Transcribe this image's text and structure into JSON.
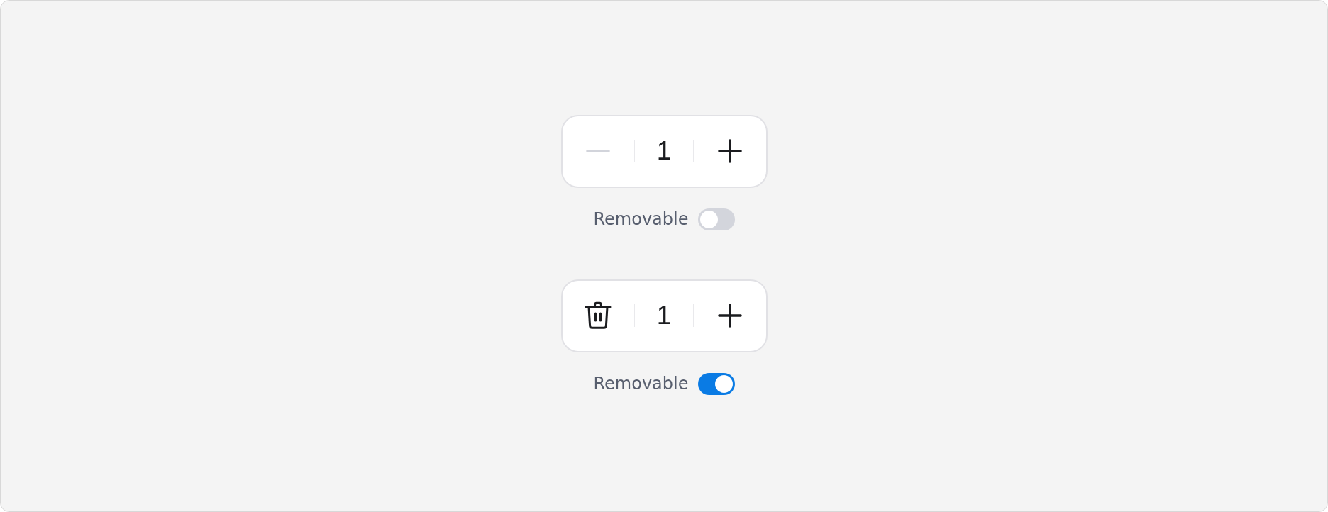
{
  "steppers": [
    {
      "decrement": {
        "kind": "minus",
        "disabled": true
      },
      "value": "1",
      "increment": {
        "disabled": false
      },
      "toggle": {
        "label": "Removable",
        "on": false
      }
    },
    {
      "decrement": {
        "kind": "trash",
        "disabled": false
      },
      "value": "1",
      "increment": {
        "disabled": false
      },
      "toggle": {
        "label": "Removable",
        "on": true
      }
    }
  ]
}
